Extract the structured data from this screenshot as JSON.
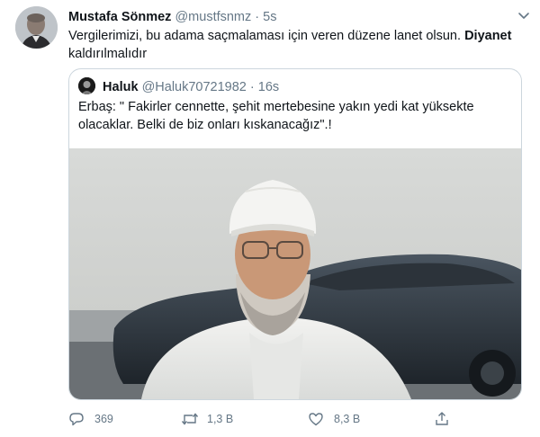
{
  "tweet": {
    "author_name": "Mustafa Sönmez",
    "handle": "@mustfsnmz",
    "separator": "·",
    "time": "5s",
    "text_part1": "Vergilerimizi, bu adama saçmalaması için veren düzene lanet olsun.",
    "text_bold": "Diyanet",
    "text_part2": "kaldırılmalıdır"
  },
  "quoted": {
    "author_name": "Haluk",
    "handle": "@Haluk70721982",
    "separator": "·",
    "time": "16s",
    "text": "Erbaş: \" Fakirler cennette, şehit mertebesine yakın yedi kat yüksekte olacaklar. Belki de biz onları kıskanacağız\".!"
  },
  "actions": {
    "reply_count": "369",
    "retweet_count": "1,3 B",
    "like_count": "8,3 B"
  },
  "icons": [
    "chevron-down-icon",
    "reply-icon",
    "retweet-icon",
    "like-icon",
    "share-icon"
  ],
  "colors": {
    "text": "#0f1419",
    "secondary": "#657786",
    "border": "#ccd6dd"
  }
}
